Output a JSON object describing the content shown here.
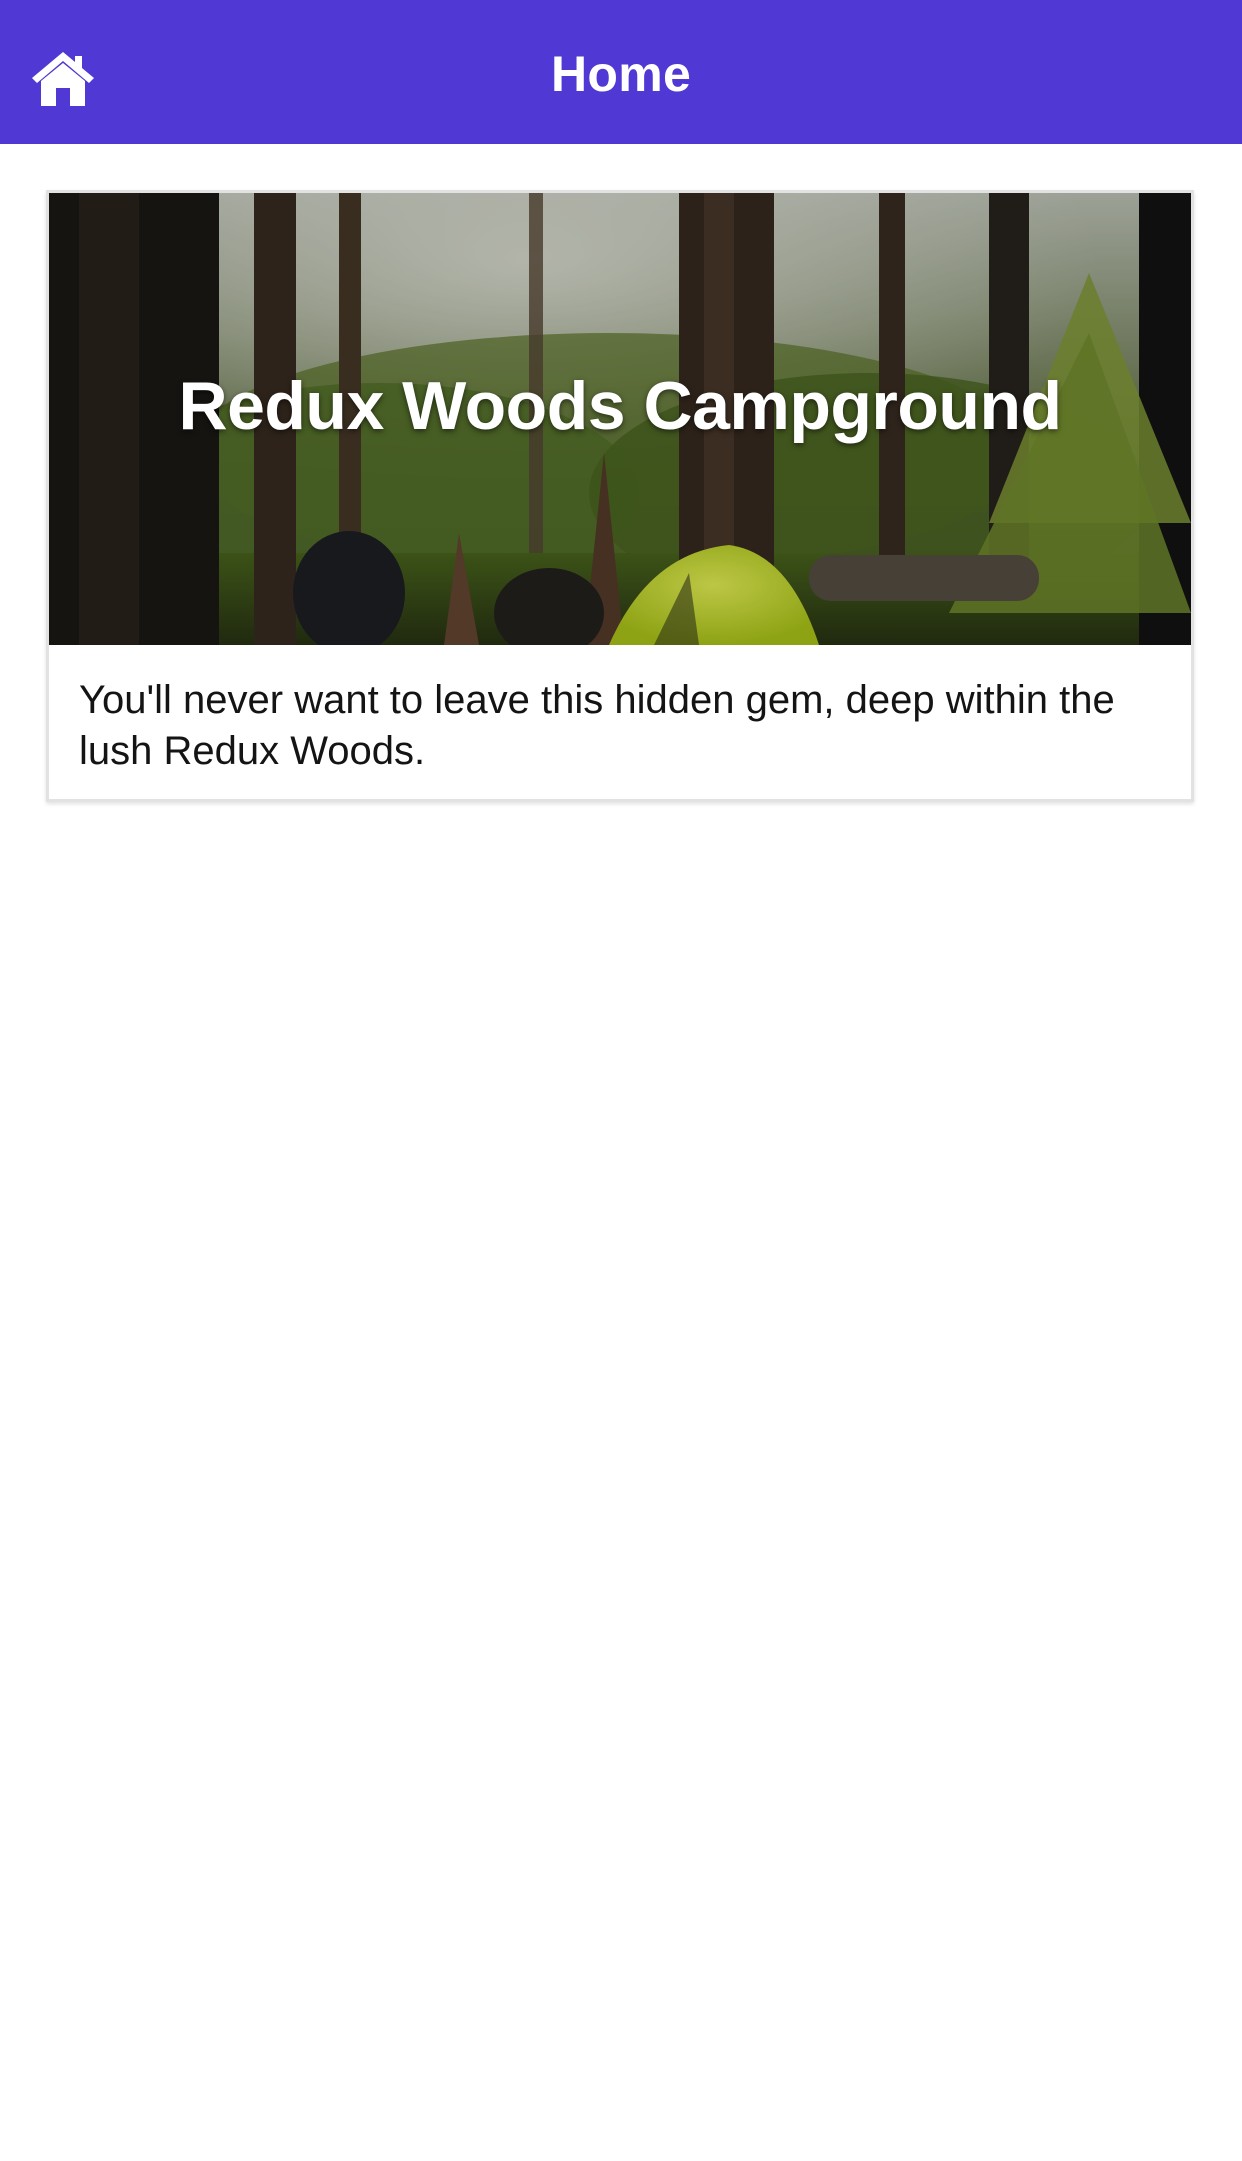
{
  "header": {
    "title": "Home",
    "home_icon": "home-icon",
    "background_color": "#4f38d3"
  },
  "campgrounds": [
    {
      "name": "Redux Woods Campground",
      "description": "You'll never want to leave this hidden gem, deep within the lush Redux Woods."
    }
  ]
}
